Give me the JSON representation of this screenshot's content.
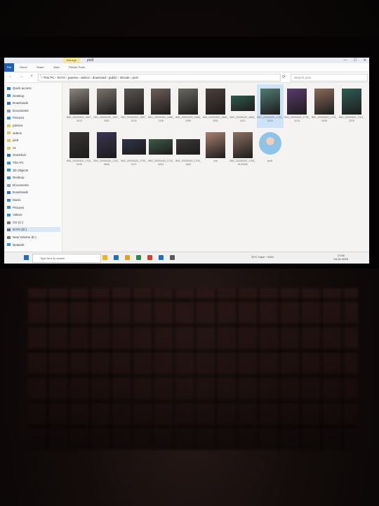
{
  "window": {
    "title": "pic8",
    "manage_tab": "Manage",
    "controls": [
      "—",
      "☐",
      "✕"
    ]
  },
  "menu": {
    "file": "File",
    "items": [
      "Home",
      "Share",
      "View",
      "Picture Tools"
    ]
  },
  "address": {
    "path": "› This PC › DATA › parena › videos › download › public › intrude › pic8",
    "search_placeholder": "Search pic8"
  },
  "nav": {
    "items": [
      {
        "label": "Quick access",
        "icon": "star-icon",
        "color": "#2c6fc7"
      },
      {
        "label": "Desktop",
        "icon": "desktop-icon",
        "color": "#3b8fd6"
      },
      {
        "label": "Downloads",
        "icon": "download-icon",
        "color": "#2c6fc7"
      },
      {
        "label": "Documents",
        "icon": "document-icon",
        "color": "#8a9bb3"
      },
      {
        "label": "Pictures",
        "icon": "picture-icon",
        "color": "#3b8fd6"
      },
      {
        "label": "parena",
        "icon": "folder-icon",
        "color": "#e8c25a"
      },
      {
        "label": "videos",
        "icon": "folder-icon",
        "color": "#e8c25a"
      },
      {
        "label": "pic8",
        "icon": "folder-icon",
        "color": "#e8c25a"
      },
      {
        "label": "v1",
        "icon": "folder-icon",
        "color": "#e8c25a"
      },
      {
        "label": "OneDrive",
        "icon": "cloud-icon",
        "color": "#2c6fc7"
      },
      {
        "label": "This PC",
        "icon": "computer-icon",
        "color": "#3b8fd6"
      },
      {
        "label": "3D Objects",
        "icon": "cube-icon",
        "color": "#3b8fd6"
      },
      {
        "label": "Desktop",
        "icon": "desktop-icon",
        "color": "#3b8fd6"
      },
      {
        "label": "Documents",
        "icon": "document-icon",
        "color": "#8a9bb3"
      },
      {
        "label": "Downloads",
        "icon": "download-icon",
        "color": "#2c6fc7"
      },
      {
        "label": "Music",
        "icon": "music-icon",
        "color": "#3b8fd6"
      },
      {
        "label": "Pictures",
        "icon": "picture-icon",
        "color": "#3b8fd6"
      },
      {
        "label": "Videos",
        "icon": "video-icon",
        "color": "#3b8fd6"
      },
      {
        "label": "OS (C:)",
        "icon": "drive-icon",
        "color": "#777777"
      },
      {
        "label": "DATA (D:)",
        "icon": "drive-icon",
        "color": "#777777"
      },
      {
        "label": "New Volume (E:)",
        "icon": "drive-icon",
        "color": "#777777"
      },
      {
        "label": "Network",
        "icon": "network-icon",
        "color": "#3b8fd6"
      }
    ],
    "selected_index": 19
  },
  "files": [
    {
      "name": "IMG_20200420_1657_2413",
      "thumb": "#8c8580"
    },
    {
      "name": "IMG_20200420_1657_2552",
      "thumb": "#7a746c"
    },
    {
      "name": "IMG_20200420_1657_3120",
      "thumb": "#5b5552"
    },
    {
      "name": "IMG_20200420_1658_1116",
      "thumb": "#6d5f5a"
    },
    {
      "name": "IMG_20200420_1658_2459",
      "thumb": "#6a6862"
    },
    {
      "name": "IMG_20200420_1659_2051",
      "thumb": "#4a3f3c"
    },
    {
      "name": "IMG_20200420_1659_4112",
      "thumb": "#2f5a4e"
    },
    {
      "name": "IMG_20200420_1700_3125",
      "thumb": "#4f7c70"
    },
    {
      "name": "IMG_20200420_1700_4214",
      "thumb": "#5a3a6e"
    },
    {
      "name": "IMG_20200420_1701_0525",
      "thumb": "#8a6a58"
    },
    {
      "name": "IMG_20200420_1701_2315",
      "thumb": "#2d5e55"
    },
    {
      "name": "IMG_20200420_1702_0245",
      "thumb": "#3a3535"
    },
    {
      "name": "IMG_20200420_1702_3846",
      "thumb": "#3b3552"
    },
    {
      "name": "IMG_20200420_1703_1127",
      "thumb": "#2e3448"
    },
    {
      "name": "IMG_20200420_1703_4021",
      "thumb": "#3e5a48"
    },
    {
      "name": "IMG_20200420_1704_1452",
      "thumb": "#3c3a38"
    },
    {
      "name": "cva",
      "thumb": "#a88070"
    },
    {
      "name": "IMG_20200420_1705_5123305",
      "thumb": "#8a7060"
    },
    {
      "name": "pic8",
      "thumb": "#8fc3e8"
    }
  ],
  "selected_file_index": 7,
  "status": "19 items   1 item selected",
  "taskbar": {
    "search_placeholder": "Type here to search",
    "apps": [
      "#f0b400",
      "#1f6fc4",
      "#e8a020",
      "#2c8a4c",
      "#d43f2f",
      "#1f6fc4",
      "#5a5a5a"
    ],
    "tray": "33°C  Haze  ^  ENG",
    "time": "17:05",
    "date": "04-21-2020"
  }
}
